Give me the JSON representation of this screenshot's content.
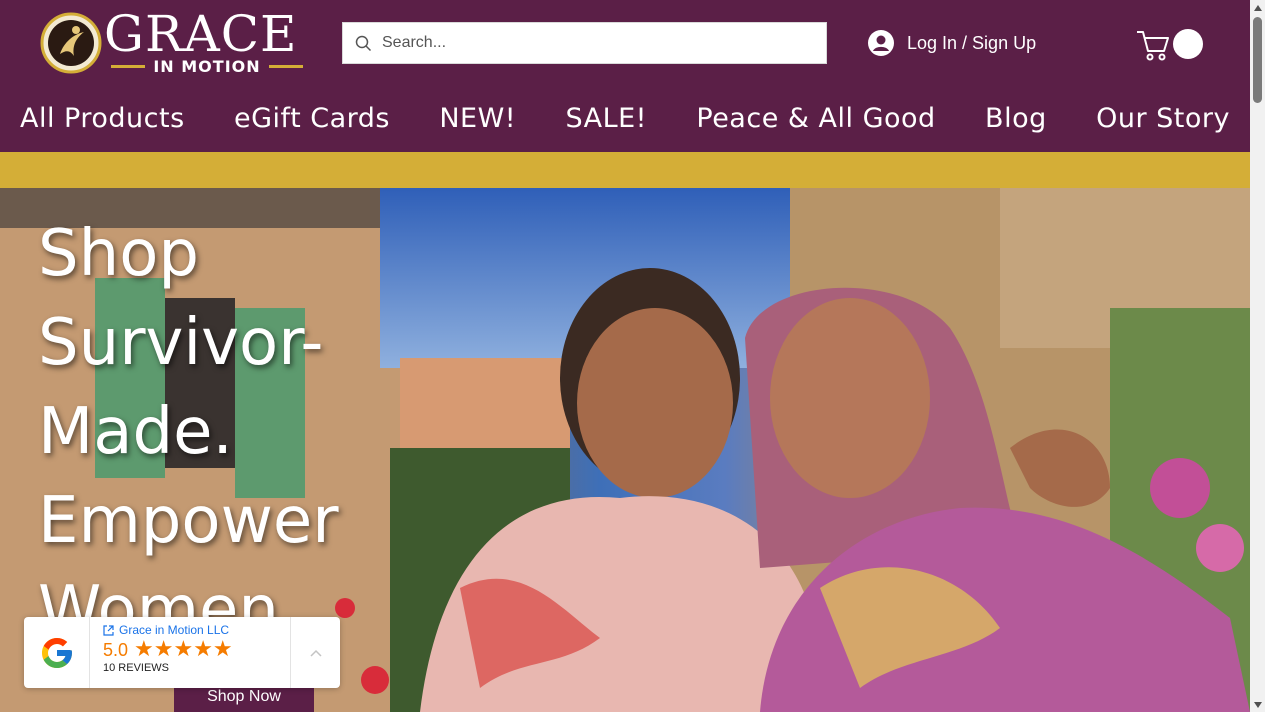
{
  "header": {
    "logo": {
      "word": "GRACE",
      "sub": "IN MOTION"
    },
    "search": {
      "placeholder": "Search..."
    },
    "login_label": "Log In / Sign Up",
    "cart_icon": "cart-icon"
  },
  "nav": {
    "items": [
      {
        "label": "All Products"
      },
      {
        "label": "eGift Cards"
      },
      {
        "label": "NEW!"
      },
      {
        "label": "SALE!"
      },
      {
        "label": "Peace & All Good"
      },
      {
        "label": "Blog"
      },
      {
        "label": "Our Story"
      }
    ]
  },
  "hero": {
    "title_lines": [
      "Shop",
      "Survivor-",
      "Made.",
      "Empower",
      "Women"
    ],
    "cta_label": "Shop Now"
  },
  "google_reviews": {
    "business": "Grace in Motion LLC",
    "score": "5.0",
    "stars": 5,
    "count_label": "10 REVIEWS"
  },
  "colors": {
    "brand_purple": "#5b1f47",
    "gold": "#d4ae37",
    "star_orange": "#f57c00",
    "link_blue": "#1a73e8"
  }
}
